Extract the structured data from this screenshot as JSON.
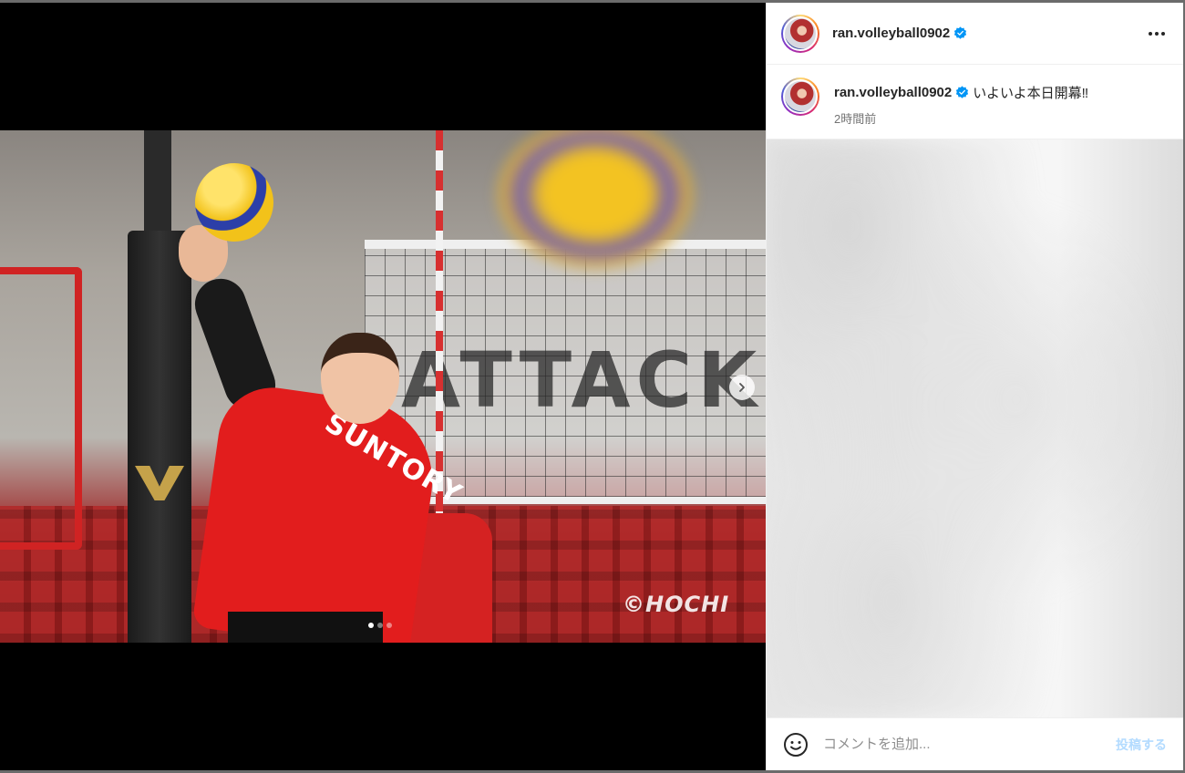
{
  "post": {
    "username": "ran.volleyball0902",
    "verified": true,
    "caption_text": "いよいよ本日開幕‼",
    "time_ago": "2時間前"
  },
  "media": {
    "watermark": "©HOCHI",
    "jersey_text": "SUNTORY",
    "wall_text": "ATTACK T",
    "carousel": {
      "total": 3,
      "current": 1
    }
  },
  "comment_box": {
    "placeholder": "コメントを追加...",
    "post_label": "投稿する"
  },
  "icons": {
    "more": "more-options-icon",
    "next": "chevron-right-icon",
    "emoji": "emoji-icon",
    "verified": "verified-badge-icon"
  },
  "colors": {
    "verified": "#0095f6",
    "post_disabled": "#b3dbff"
  }
}
